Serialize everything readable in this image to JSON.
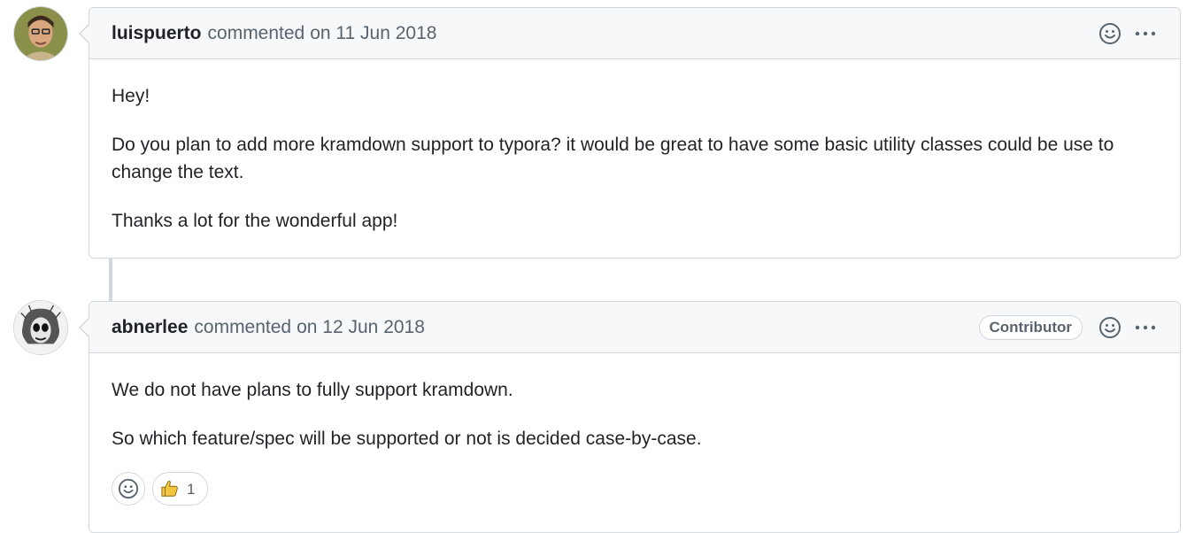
{
  "comments": [
    {
      "author": "luispuerto",
      "action": "commented",
      "date": "on 11 Jun 2018",
      "paragraphs": [
        "Hey!",
        "Do you plan to add more kramdown support to typora? it would be great to have some basic utility classes could be use to change the text.",
        "Thanks a lot for the wonderful app!"
      ],
      "icons": [
        "smiley-icon",
        "kebab-menu-icon"
      ]
    },
    {
      "author": "abnerlee",
      "action": "commented",
      "date": "on 12 Jun 2018",
      "badge": "Contributor",
      "paragraphs": [
        "We do not have plans to fully support kramdown.",
        "So which feature/spec will be supported or not is decided case-by-case."
      ],
      "reactions": [
        {
          "emoji": "thumbs-up-icon",
          "count": "1"
        }
      ],
      "icons": [
        "smiley-icon",
        "kebab-menu-icon"
      ]
    }
  ],
  "colors": {
    "border": "#d0d7de",
    "header_bg": "#f6f8fa",
    "muted_text": "#59636e",
    "text": "#1f2328"
  }
}
